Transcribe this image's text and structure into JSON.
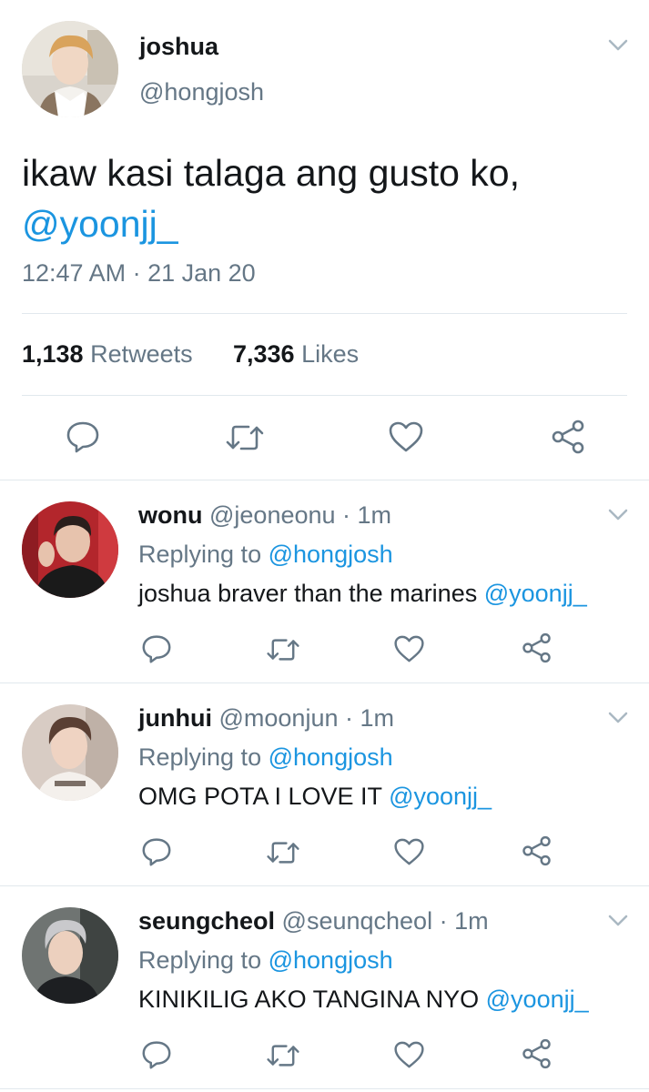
{
  "main_tweet": {
    "name": "joshua",
    "handle": "@hongjosh",
    "text": "ikaw kasi talaga ang gusto ko,",
    "mention": "@yoonjj_",
    "timestamp": "12:47 AM · 21 Jan 20",
    "retweets_count": "1,138",
    "retweets_label": "Retweets",
    "likes_count": "7,336",
    "likes_label": "Likes"
  },
  "replies": [
    {
      "name": "wonu",
      "handle": "@jeoneonu",
      "time": "· 1m",
      "replying_label": "Replying to",
      "replying_to": "@hongjosh",
      "text": "joshua braver than the marines",
      "mention": "@yoonjj_"
    },
    {
      "name": "junhui",
      "handle": "@moonjun",
      "time": "· 1m",
      "replying_label": "Replying to",
      "replying_to": "@hongjosh",
      "text": "OMG POTA I LOVE IT",
      "mention": "@yoonjj_"
    },
    {
      "name": "seungcheol",
      "handle": "@seunqcheol",
      "time": "· 1m",
      "replying_label": "Replying to",
      "replying_to": "@hongjosh",
      "text": "KINIKILIG AKO TANGINA NYO",
      "mention": "@yoonjj_"
    }
  ],
  "icons": [
    "chevron-down-icon",
    "reply-icon",
    "retweet-icon",
    "like-icon",
    "share-icon"
  ],
  "colors": {
    "link": "#1b95e0",
    "muted": "#657786",
    "divider": "#e1e8ed",
    "icon": "#657786"
  }
}
